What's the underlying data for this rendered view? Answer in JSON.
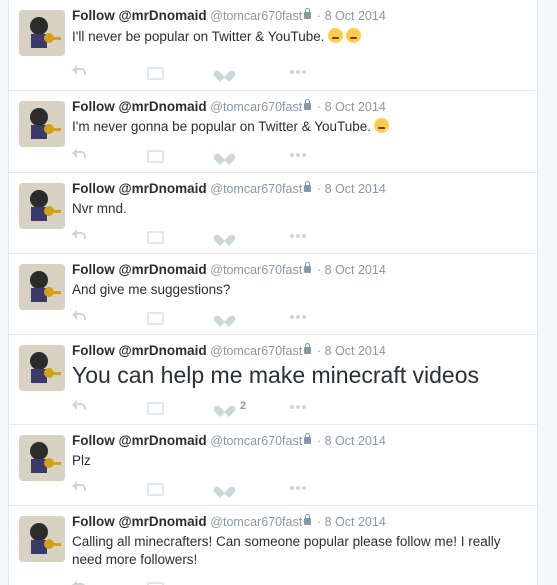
{
  "tweets": [
    {
      "fullname": "Follow @mrDnomaid",
      "username": "@tomcar670fast",
      "time": "8 Oct 2014",
      "text": "I'll never be popular on Twitter & YouTube.",
      "emojis": [
        "pensive-face-emoji",
        "crying-face-emoji"
      ],
      "favorites": ""
    },
    {
      "fullname": "Follow @mrDnomaid",
      "username": "@tomcar670fast",
      "time": "8 Oct 2014",
      "text": "I'm never gonna be popular on Twitter & YouTube.",
      "emojis": [
        "pensive-face-emoji"
      ],
      "favorites": ""
    },
    {
      "fullname": "Follow @mrDnomaid",
      "username": "@tomcar670fast",
      "time": "8 Oct 2014",
      "text": "Nvr mnd.",
      "emojis": [],
      "favorites": ""
    },
    {
      "fullname": "Follow @mrDnomaid",
      "username": "@tomcar670fast",
      "time": "8 Oct 2014",
      "text": "And give me suggestions?",
      "emojis": [],
      "favorites": ""
    },
    {
      "fullname": "Follow @mrDnomaid",
      "username": "@tomcar670fast",
      "time": "8 Oct 2014",
      "text": "You can help me make minecraft videos",
      "emojis": [],
      "favorites": "2"
    },
    {
      "fullname": "Follow @mrDnomaid",
      "username": "@tomcar670fast",
      "time": "8 Oct 2014",
      "text": "Plz",
      "emojis": [],
      "favorites": ""
    },
    {
      "fullname": "Follow @mrDnomaid",
      "username": "@tomcar670fast",
      "time": "8 Oct 2014",
      "text": "Calling all minecrafters! Can someone popular please follow me! I really need more followers!",
      "emojis": [],
      "favorites": ""
    }
  ],
  "separator": "·",
  "colors": {
    "background": "#f5f8fa",
    "card": "#ffffff",
    "border": "#e1e8ed",
    "muted": "#8899a6",
    "text": "#292f33",
    "icon": "#ccd6dd"
  },
  "icons": [
    "reply-icon",
    "retweet-icon",
    "favorite-icon",
    "more-icon",
    "lock-icon"
  ]
}
